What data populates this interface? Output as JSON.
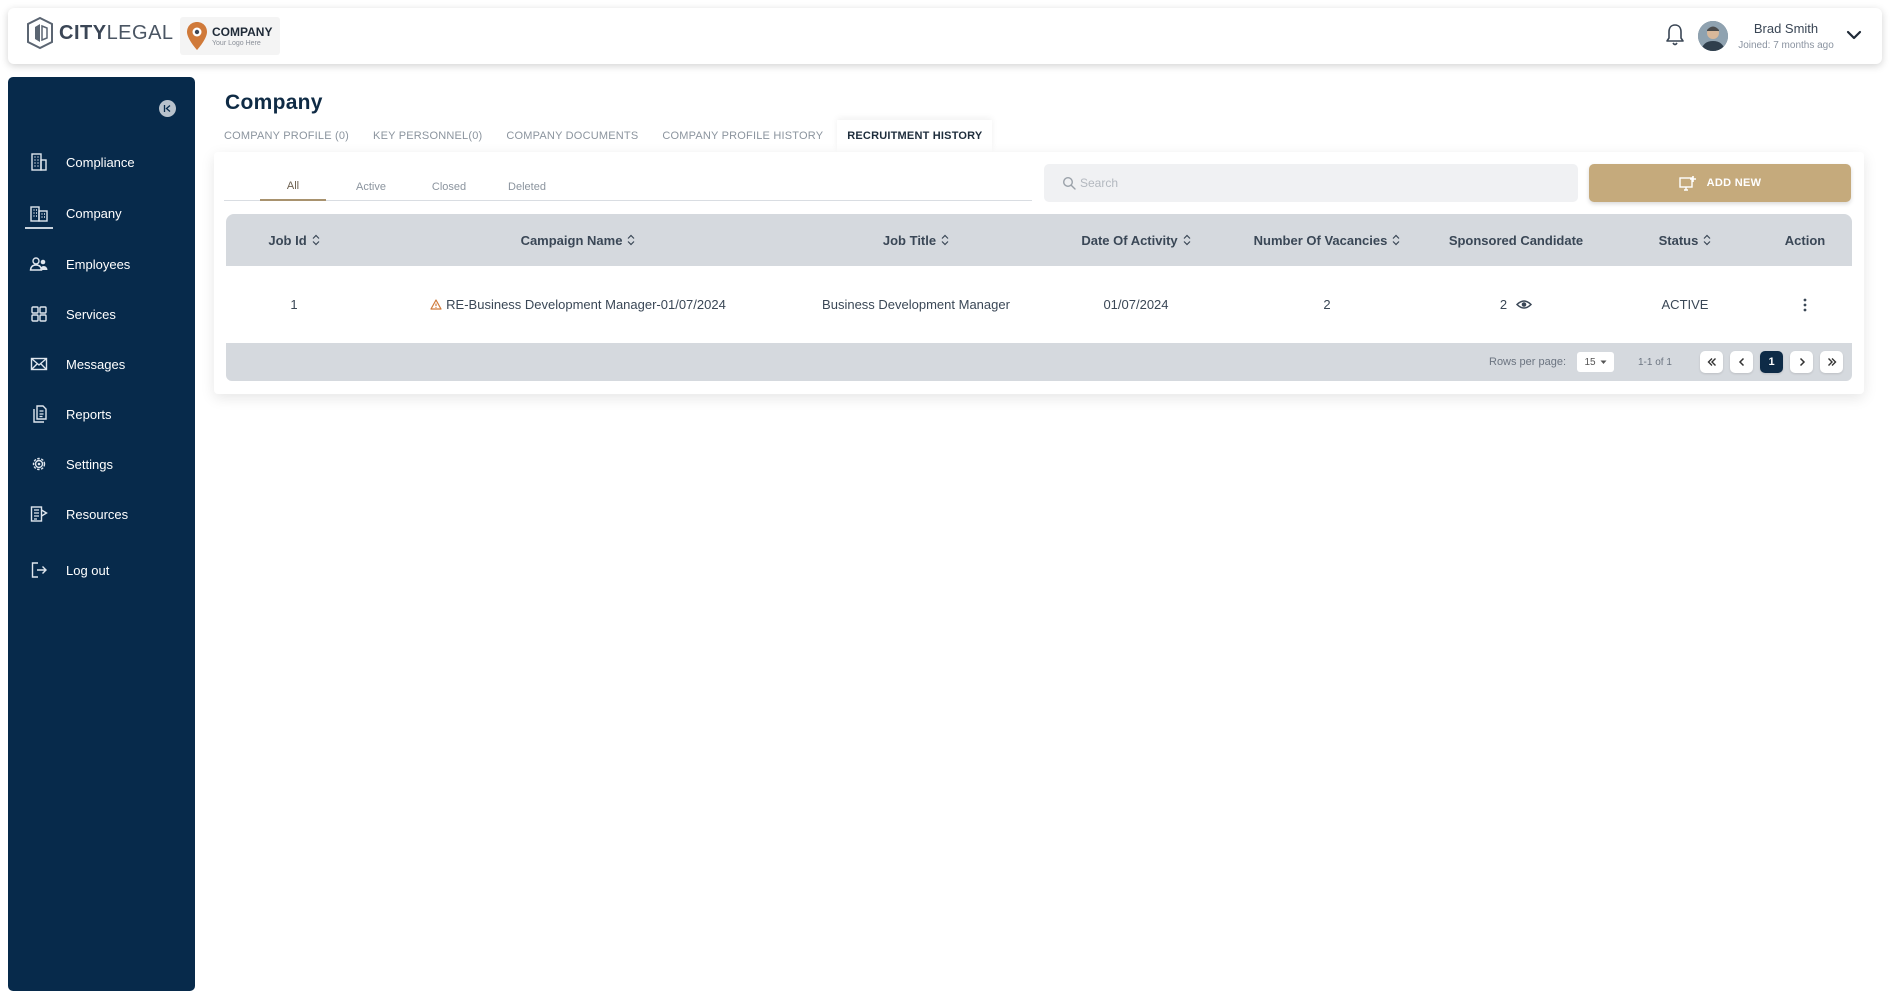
{
  "header": {
    "brand_bold": "CITY",
    "brand_light": "LEGAL",
    "company_logo_name": "COMPANY",
    "company_logo_tagline": "Your Logo Here",
    "user_name": "Brad Smith",
    "user_joined": "Joined: 7 months ago"
  },
  "sidebar": {
    "items": [
      {
        "label": "Compliance",
        "icon": "building-icon"
      },
      {
        "label": "Company",
        "icon": "city-icon"
      },
      {
        "label": "Employees",
        "icon": "users-icon"
      },
      {
        "label": "Services",
        "icon": "grid-icon"
      },
      {
        "label": "Messages",
        "icon": "envelope-icon"
      },
      {
        "label": "Reports",
        "icon": "documents-icon"
      },
      {
        "label": "Settings",
        "icon": "gear-icon"
      },
      {
        "label": "Resources",
        "icon": "resources-icon"
      },
      {
        "label": "Log out",
        "icon": "logout-icon"
      }
    ],
    "active_index": 1
  },
  "main": {
    "title": "Company",
    "tabs": [
      {
        "label": "COMPANY PROFILE (0)"
      },
      {
        "label": "KEY PERSONNEL(0)"
      },
      {
        "label": "COMPANY DOCUMENTS"
      },
      {
        "label": "COMPANY PROFILE HISTORY"
      },
      {
        "label": "RECRUITMENT HISTORY"
      }
    ],
    "active_tab": 4,
    "filters": [
      {
        "label": "All"
      },
      {
        "label": "Active"
      },
      {
        "label": "Closed"
      },
      {
        "label": "Deleted"
      }
    ],
    "active_filter": 0,
    "search": {
      "placeholder": "Search"
    },
    "add_button": "ADD NEW"
  },
  "table": {
    "columns": [
      {
        "label": "Job Id",
        "sortable": true
      },
      {
        "label": "Campaign Name",
        "sortable": true
      },
      {
        "label": "Job Title",
        "sortable": true
      },
      {
        "label": "Date Of Activity",
        "sortable": true
      },
      {
        "label": "Number Of Vacancies",
        "sortable": true
      },
      {
        "label": "Sponsored Candidate",
        "sortable": false
      },
      {
        "label": "Status",
        "sortable": true
      },
      {
        "label": "Action",
        "sortable": false
      }
    ],
    "rows": [
      {
        "job_id": "1",
        "campaign_name": "RE-Business Development Manager-01/07/2024",
        "job_title": "Business Development Manager",
        "date_of_activity": "01/07/2024",
        "vacancies": "2",
        "sponsored_candidate": "2",
        "status": "ACTIVE"
      }
    ]
  },
  "pagination": {
    "rows_per_page_label": "Rows per page:",
    "rows_per_page": "15",
    "range": "1-1 of 1",
    "current_page": "1"
  },
  "colors": {
    "sidebar_bg": "#072a4b",
    "accent_gold": "#c5aa7c",
    "table_header_bg": "#d5d9de",
    "active_page": "#0e2b47"
  }
}
